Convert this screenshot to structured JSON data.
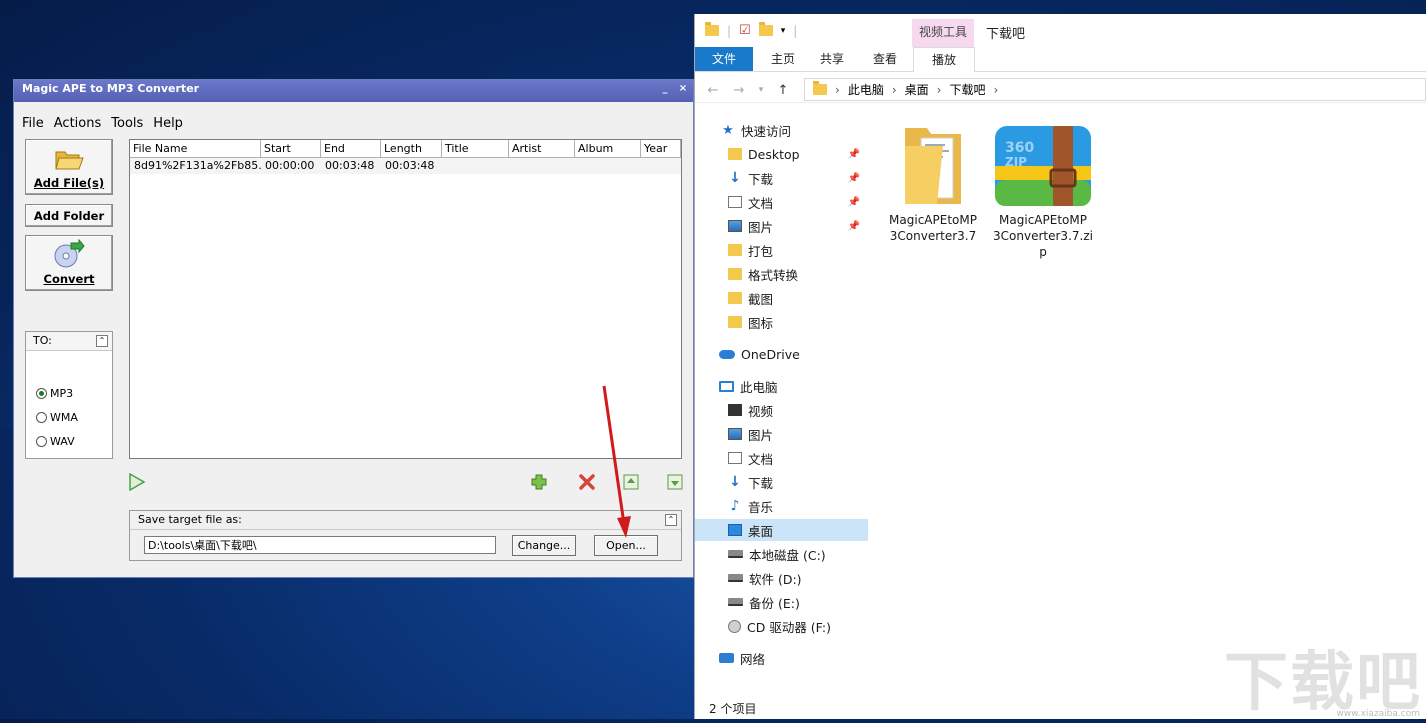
{
  "ape_window": {
    "title": "Magic APE to MP3 Converter",
    "controls": [
      "_",
      "×"
    ],
    "menu": [
      "File",
      "Actions",
      "Tools",
      "Help"
    ],
    "buttons": {
      "add_files": "Add File(s)",
      "add_folder": "Add Folder",
      "convert": "Convert"
    },
    "to_panel": {
      "header": "TO:",
      "formats": [
        "MP3",
        "WMA",
        "WAV"
      ],
      "selected": "MP3"
    },
    "file_list": {
      "columns": [
        "File Name",
        "Start",
        "End",
        "Length",
        "Title",
        "Artist",
        "Album",
        "Year"
      ],
      "rows": [
        [
          "8d91%2F131a%2Fb85...",
          "00:00:00",
          "00:03:48",
          "00:03:48",
          "",
          "",
          "",
          ""
        ]
      ]
    },
    "save_panel": {
      "header": "Save target file as:",
      "path": "D:\\tools\\桌面\\下载吧\\",
      "change_label": "Change...",
      "open_label": "Open..."
    },
    "icons": [
      "play-icon",
      "add-icon",
      "remove-icon",
      "move-up-icon",
      "move-down-icon"
    ]
  },
  "explorer": {
    "context_tab": "视频工具",
    "title": "下载吧",
    "ribbon_tabs": [
      "文件",
      "主页",
      "共享",
      "查看",
      "播放"
    ],
    "breadcrumb": [
      "此电脑",
      "桌面",
      "下载吧"
    ],
    "nav": {
      "quick_access": "快速访问",
      "quick_items": [
        {
          "label": "Desktop",
          "icon": "folder",
          "pinned": true
        },
        {
          "label": "下载",
          "icon": "download",
          "pinned": true
        },
        {
          "label": "文档",
          "icon": "document",
          "pinned": true
        },
        {
          "label": "图片",
          "icon": "picture",
          "pinned": true
        },
        {
          "label": "打包",
          "icon": "folder",
          "pinned": false
        },
        {
          "label": "格式转换",
          "icon": "folder",
          "pinned": false
        },
        {
          "label": "截图",
          "icon": "folder",
          "pinned": false
        },
        {
          "label": "图标",
          "icon": "folder",
          "pinned": false
        }
      ],
      "onedrive": "OneDrive",
      "this_pc": "此电脑",
      "pc_items": [
        {
          "label": "视频",
          "icon": "video"
        },
        {
          "label": "图片",
          "icon": "picture"
        },
        {
          "label": "文档",
          "icon": "document"
        },
        {
          "label": "下载",
          "icon": "download"
        },
        {
          "label": "音乐",
          "icon": "music"
        },
        {
          "label": "桌面",
          "icon": "desktop"
        },
        {
          "label": "本地磁盘 (C:)",
          "icon": "drive"
        },
        {
          "label": "软件 (D:)",
          "icon": "drive"
        },
        {
          "label": "备份 (E:)",
          "icon": "drive"
        },
        {
          "label": "CD 驱动器 (F:)",
          "icon": "cd"
        }
      ],
      "network": "网络",
      "selected": "桌面"
    },
    "files": [
      {
        "name_line1": "MagicAPEtoMP",
        "name_line2": "3Converter3.7",
        "name_line3": "",
        "icon": "folder-icon"
      },
      {
        "name_line1": "MagicAPEtoMP",
        "name_line2": "3Converter3.7.zi",
        "name_line3": "p",
        "icon": "zip-archive-icon"
      }
    ],
    "status": "2 个项目"
  },
  "watermark": "下载吧",
  "watermark_url": "www.xiazaiba.com",
  "colors": {
    "ape_title": "#5a66bb",
    "file_tab": "#1979ca",
    "selected_nav": "#cce4f7",
    "context_tab": "#f6d9ef",
    "arrow": "#d11b1b"
  }
}
